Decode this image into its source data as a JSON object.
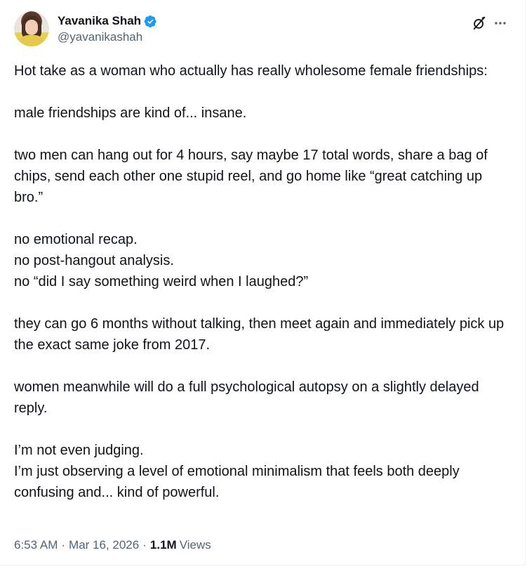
{
  "author": {
    "display_name": "Yavanika Shah",
    "handle": "@yavanikashah",
    "verified": true,
    "avatar_icon": "profile-photo"
  },
  "actions": {
    "grok_icon": "grok-icon",
    "more_icon": "more-icon",
    "more_label": "···"
  },
  "tweet": {
    "paragraphs": [
      "Hot take as a woman who actually has really wholesome female friendships:",
      "male friendships are kind of... insane.",
      "two men can hang out for 4 hours, say maybe 17 total words, share a bag of chips, send each other one stupid reel, and go home like “great catching up bro.”",
      "no emotional recap.\nno post-hangout analysis.\nno “did I say something weird when I laughed?”",
      "they can go 6 months without talking, then meet again and immediately pick up the exact same joke from 2017.",
      "women meanwhile will do a full psychological autopsy on a slightly delayed reply.",
      "I’m not even judging.\nI’m just observing a level of emotional minimalism that feels both deeply confusing and... kind of powerful."
    ]
  },
  "meta": {
    "time": "6:53 AM",
    "separator": "·",
    "date": "Mar 16, 2026",
    "views_count": "1.1M",
    "views_label": "Views"
  },
  "colors": {
    "text": "#0f1419",
    "secondary": "#536471",
    "verified_blue": "#1d9bf0"
  }
}
